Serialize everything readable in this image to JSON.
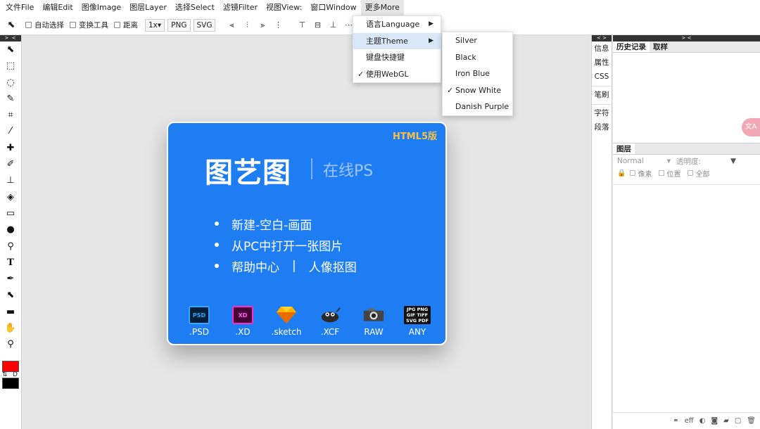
{
  "menubar": [
    "文件File",
    "编辑Edit",
    "图像Image",
    "图层Layer",
    "选择Select",
    "滤镜Filter",
    "视图View:",
    "窗口Window",
    "更多More"
  ],
  "options": {
    "auto_select": "自动选择",
    "transform_tools": "变换工具",
    "distance": "距离",
    "scale": "1x▾",
    "png": "PNG",
    "svg": "SVG"
  },
  "more_menu": {
    "language": "语言Language",
    "theme": "主题Theme",
    "shortcuts": "键盘快捷键",
    "webgl": "使用WebGL",
    "webgl_check": "✓"
  },
  "theme_menu": {
    "items": [
      "Silver",
      "Black",
      "Iron Blue",
      "Snow White",
      "Danish Purple"
    ],
    "checked": "✓"
  },
  "card": {
    "badge": "HTML5版",
    "title": "图艺图",
    "subtitle": "在线PS",
    "link_new": "新建-空白-画面",
    "link_open": "从PC中打开一张图片",
    "link_help": "帮助中心",
    "link_sep": "|",
    "link_cutout": "人像抠图",
    "formats": [
      {
        "label": ".PSD",
        "icon_text": "PSD"
      },
      {
        "label": ".XD",
        "icon_text": "XD"
      },
      {
        "label": ".sketch",
        "icon_text": ""
      },
      {
        "label": ".XCF",
        "icon_text": ""
      },
      {
        "label": "RAW",
        "icon_text": ""
      },
      {
        "label": "ANY",
        "icon_text": "JPG PNG GIF TIFF SVG PDF"
      }
    ]
  },
  "right_narrow": [
    "信息",
    "属性",
    "CSS",
    "笔刷",
    "字符",
    "段落"
  ],
  "right_panel": {
    "tab_history": "历史记录",
    "tab_swatch": "取样",
    "layers_tab": "图层",
    "blend_mode": "Normal",
    "opacity_label": "透明度:",
    "lock_pixels": "像素",
    "lock_position": "位置",
    "lock_all": "全部",
    "footer_eff": "eff"
  },
  "colors": {
    "foreground": "#ff0000",
    "background": "#000000",
    "card": "#1f7df4",
    "badge": "#f6c044"
  }
}
